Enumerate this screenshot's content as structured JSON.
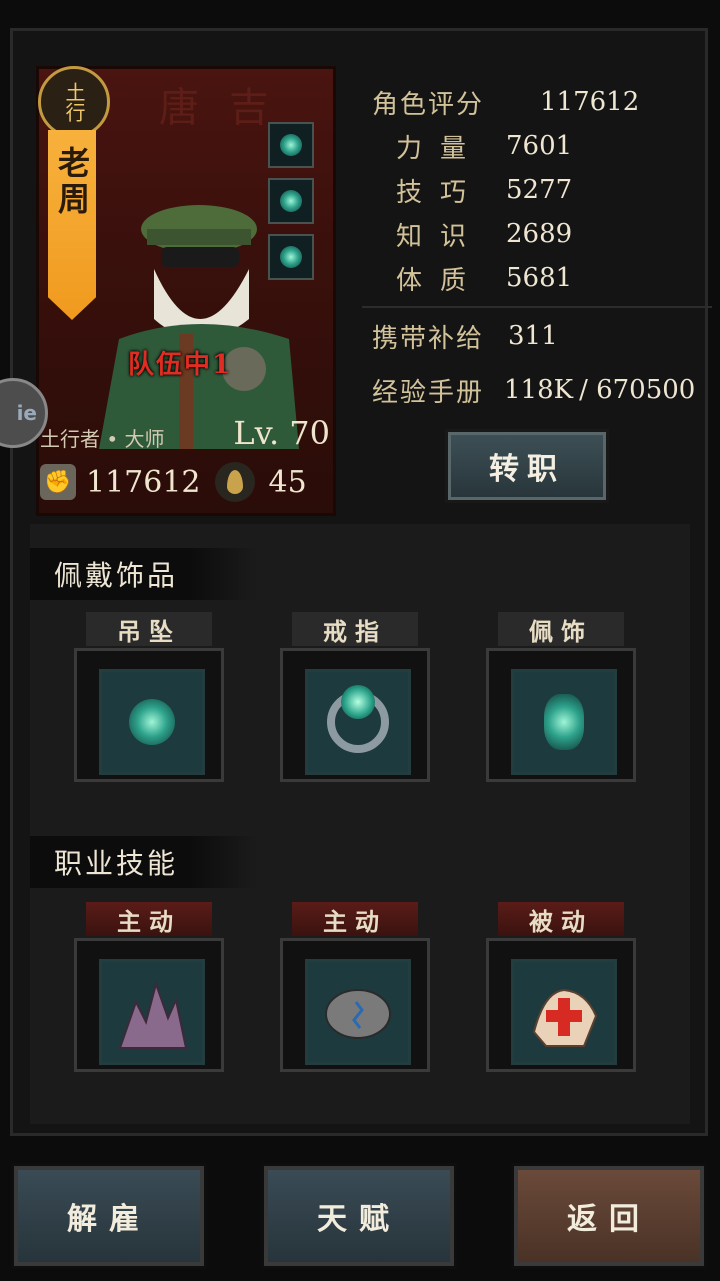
{
  "character": {
    "class_badge": "土行",
    "name": "老周",
    "team_status": "队伍中1",
    "class_title": "土行者 • 大师",
    "level": "Lv. 70",
    "power": "117612",
    "souls": "45"
  },
  "stats": {
    "rating_label": "角色评分",
    "rating_value": "117612",
    "strength_label": "力量",
    "strength_value": "7601",
    "skill_label": "技巧",
    "skill_value": "5277",
    "knowledge_label": "知识",
    "knowledge_value": "2689",
    "constitution_label": "体质",
    "constitution_value": "5681",
    "supply_label": "携带补给",
    "supply_value": "311",
    "exp_label": "经验手册",
    "exp_current": "118K",
    "exp_total": "/ 670500"
  },
  "job_button": "转职",
  "accessories": {
    "title": "佩戴饰品",
    "slots": [
      {
        "label": "吊坠",
        "icon": "pendant-icon"
      },
      {
        "label": "戒指",
        "icon": "ring-icon"
      },
      {
        "label": "佩饰",
        "icon": "charm-icon"
      }
    ]
  },
  "skills": {
    "title": "职业技能",
    "slots": [
      {
        "label": "主动",
        "icon": "earth-spike-icon"
      },
      {
        "label": "主动",
        "icon": "stone-fist-icon"
      },
      {
        "label": "被动",
        "icon": "heal-hand-icon"
      }
    ]
  },
  "buttons": {
    "dismiss": "解雇",
    "talent": "天赋",
    "back": "返回"
  },
  "colors": {
    "accent_orange": "#f09a1e",
    "exp_red": "#e02b20",
    "panel_blue": "#3a4b55"
  }
}
